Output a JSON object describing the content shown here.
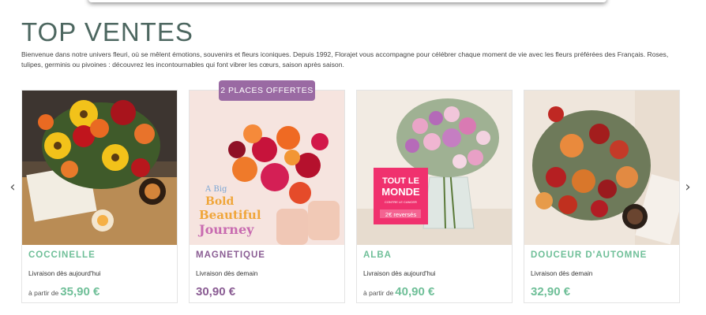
{
  "page": {
    "title": "TOP VENTES",
    "intro": "Bienvenue dans notre univers fleuri, où se mêlent émotions, souvenirs et fleurs iconiques. Depuis 1992, Florajet vous accompagne pour célébrer chaque moment de vie avec les fleurs préférées des Français. Roses, tulipes, germinis ou pivoines : découvrez les incontournables qui font vibrer les cœurs, saison après saison."
  },
  "carousel": {
    "prev_icon": "chevron-left-icon",
    "next_icon": "chevron-right-icon",
    "prev_glyph": "‹",
    "next_glyph": "›"
  },
  "products": [
    {
      "name": "COCCINELLE",
      "delivery": "Livraison dès aujourd'hui",
      "from": "à partir de",
      "price": "35,90 €",
      "color": "#6fbf98"
    },
    {
      "name": "MAGNETIQUE",
      "delivery": "Livraison dès demain",
      "from": "",
      "price": "30,90 €",
      "color": "#8a5c93",
      "badge": "2 PLACES OFFERTES",
      "image_text": [
        "A Big",
        "Bold",
        "Beautiful",
        "Journey"
      ]
    },
    {
      "name": "ALBA",
      "delivery": "Livraison dès aujourd'hui",
      "from": "à partir de",
      "price": "40,90 €",
      "color": "#6fbf98",
      "image_text": [
        "TOUT LE",
        "MONDE",
        "CONTRE LE CANCER",
        "2€ reversés"
      ]
    },
    {
      "name": "DOUCEUR D'AUTOMNE",
      "delivery": "Livraison dès demain",
      "from": "",
      "price": "32,90 €",
      "color": "#6fbf98"
    }
  ]
}
